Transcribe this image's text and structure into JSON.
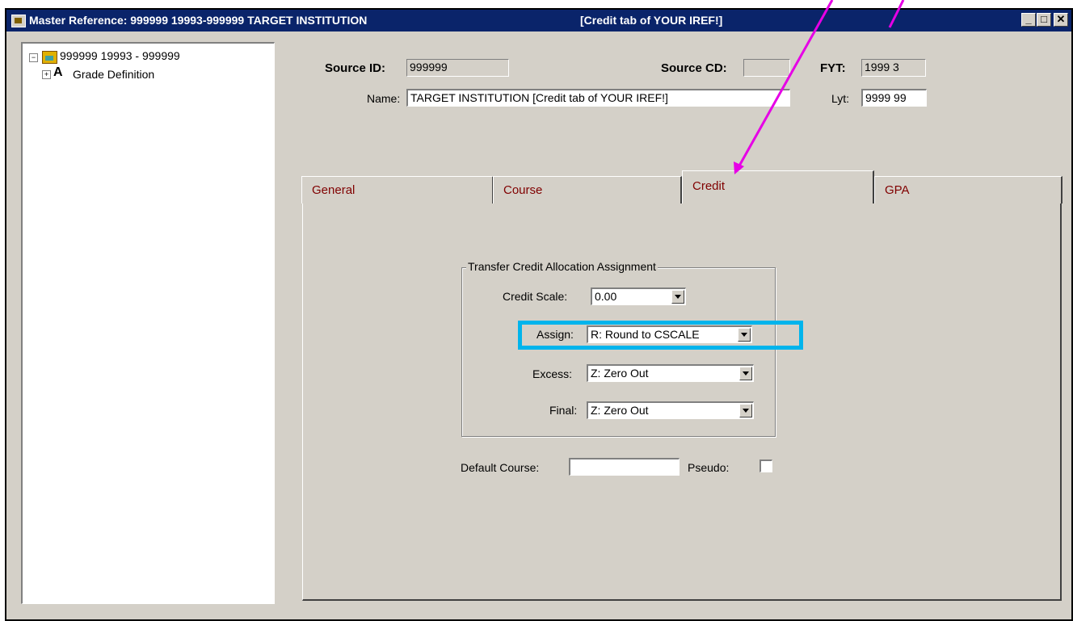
{
  "window": {
    "title": "Master Reference: 999999  19993-999999 TARGET INSTITUTION",
    "title_note": "[Credit tab of YOUR IREF!]",
    "buttons": {
      "minimize": "_",
      "maximize": "□",
      "close": "✕"
    }
  },
  "tree": {
    "root_label": "999999   19993 - 999999",
    "child_label": "Grade Definition",
    "root_toggle": "−",
    "child_toggle": "+",
    "icons": [
      "institution-icon",
      "grade-definition-icon"
    ]
  },
  "header": {
    "source_id_label": "Source ID:",
    "source_id_value": "999999",
    "source_cd_label": "Source CD:",
    "source_cd_value": "",
    "fyt_label": "FYT:",
    "fyt_value": "1999 3",
    "name_label": "Name:",
    "name_value": "TARGET INSTITUTION         [Credit tab of YOUR IREF!]",
    "lyt_label": "Lyt:",
    "lyt_value": "9999 99"
  },
  "tabs": [
    {
      "label": "General"
    },
    {
      "label": "Course"
    },
    {
      "label": "Credit",
      "active": true
    },
    {
      "label": "GPA"
    }
  ],
  "credit_tab": {
    "group_title": "Transfer Credit Allocation Assignment",
    "credit_scale_label": "Credit Scale:",
    "credit_scale_value": "0.00",
    "assign_label": "Assign:",
    "assign_value": "R: Round to CSCALE",
    "excess_label": "Excess:",
    "excess_value": "Z: Zero Out",
    "final_label": "Final:",
    "final_value": "Z: Zero Out",
    "default_course_label": "Default Course:",
    "default_course_value": "",
    "pseudo_label": "Pseudo:",
    "pseudo_checked": false
  },
  "annotations": {
    "arrow_color": "#e600e6",
    "highlight_color": "#00b4ec"
  }
}
